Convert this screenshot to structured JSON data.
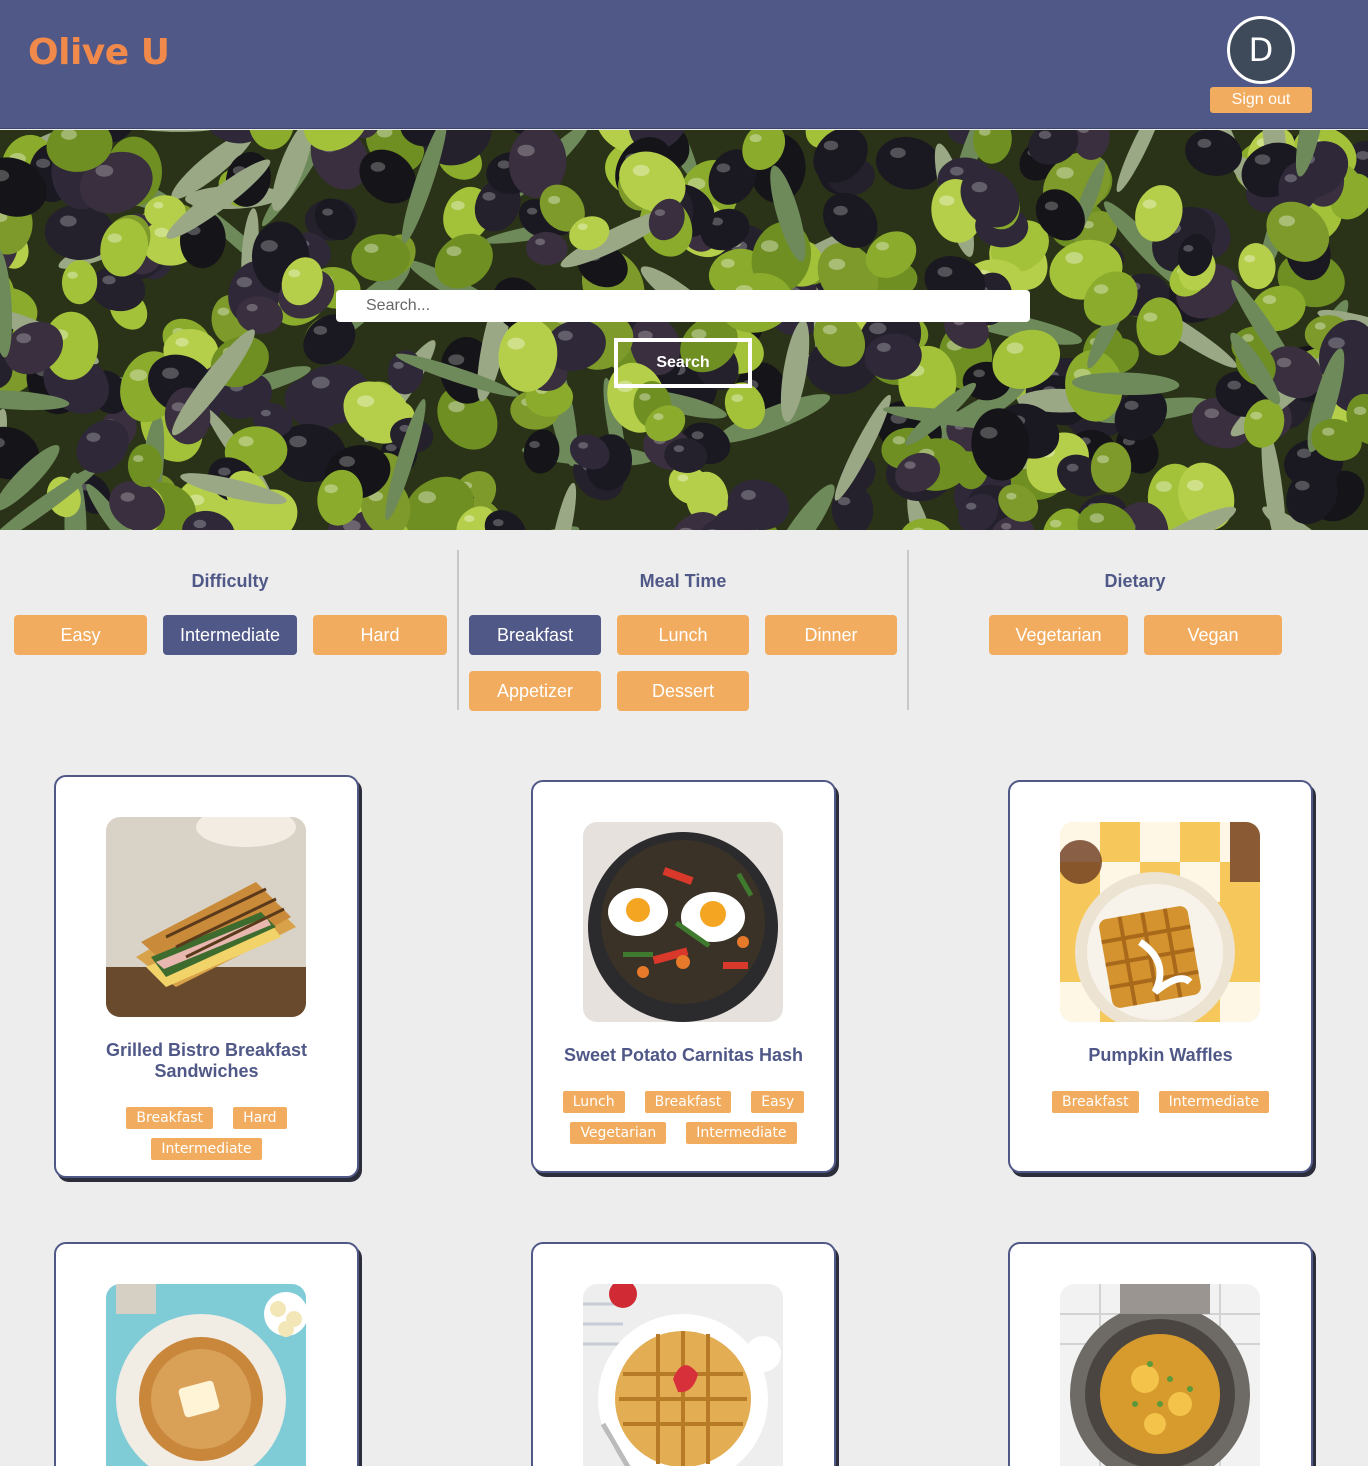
{
  "header": {
    "logo": "Olive U",
    "avatar_initial": "D",
    "signout_label": "Sign out"
  },
  "hero": {
    "search_placeholder": "Search...",
    "search_button": "Search"
  },
  "filters": {
    "difficulty": {
      "title": "Difficulty",
      "options": [
        "Easy",
        "Intermediate",
        "Hard"
      ],
      "selected": "Intermediate"
    },
    "meal_time": {
      "title": "Meal Time",
      "options": [
        "Breakfast",
        "Lunch",
        "Dinner",
        "Appetizer",
        "Dessert"
      ],
      "selected": "Breakfast"
    },
    "dietary": {
      "title": "Dietary",
      "options": [
        "Vegetarian",
        "Vegan"
      ]
    }
  },
  "recipes": [
    {
      "title": "Grilled Bistro Breakfast Sandwiches",
      "tags": [
        "Breakfast",
        "Hard",
        "Intermediate"
      ]
    },
    {
      "title": "Sweet Potato Carnitas Hash",
      "tags": [
        "Lunch",
        "Breakfast",
        "Easy",
        "Vegetarian",
        "Intermediate"
      ]
    },
    {
      "title": "Pumpkin Waffles",
      "tags": [
        "Breakfast",
        "Intermediate"
      ]
    },
    {
      "title": "",
      "tags": []
    },
    {
      "title": "",
      "tags": []
    },
    {
      "title": "",
      "tags": []
    }
  ],
  "colors": {
    "header_bg": "#505887",
    "accent_orange": "#f2ac5f",
    "logo_orange": "#f0894a",
    "active_filter": "#505887",
    "page_bg": "#ededed"
  }
}
